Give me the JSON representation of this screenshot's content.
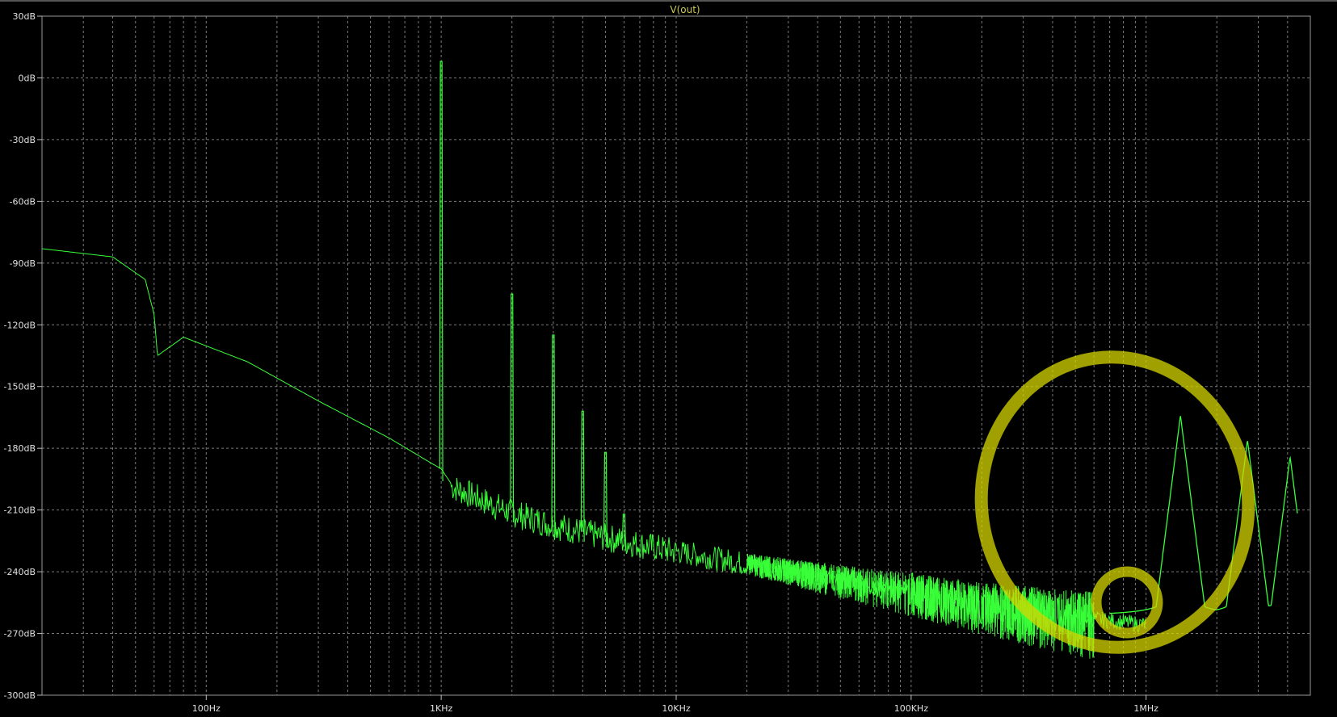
{
  "chart_data": {
    "type": "line",
    "title": "V(out)",
    "xlabel": "",
    "ylabel": "",
    "xscale": "log",
    "xlim": [
      20,
      5000000
    ],
    "ylim": [
      -300,
      30
    ],
    "grid": true,
    "colors": {
      "background": "#000000",
      "trace": "#39ff39",
      "grid": "#7a7a7a",
      "title": "#c8c850",
      "highlight": "#d6d600"
    },
    "y_ticks": [
      {
        "value": 30,
        "label": "30dB"
      },
      {
        "value": 0,
        "label": "0dB"
      },
      {
        "value": -30,
        "label": "-30dB"
      },
      {
        "value": -60,
        "label": "-60dB"
      },
      {
        "value": -90,
        "label": "-90dB"
      },
      {
        "value": -120,
        "label": "-120dB"
      },
      {
        "value": -150,
        "label": "-150dB"
      },
      {
        "value": -180,
        "label": "-180dB"
      },
      {
        "value": -210,
        "label": "-210dB"
      },
      {
        "value": -240,
        "label": "-240dB"
      },
      {
        "value": -270,
        "label": "-270dB"
      },
      {
        "value": -300,
        "label": "-300dB"
      }
    ],
    "x_ticks": [
      {
        "value": 100,
        "label": "100Hz"
      },
      {
        "value": 1000,
        "label": "1KHz"
      },
      {
        "value": 10000,
        "label": "10KHz"
      },
      {
        "value": 100000,
        "label": "100KHz"
      },
      {
        "value": 1000000,
        "label": "1MHz"
      }
    ],
    "series": [
      {
        "name": "V(out)",
        "noise_floor": {
          "x": [
            20,
            40,
            55,
            60,
            62,
            80,
            150,
            300,
            600,
            900,
            1000,
            1100,
            1500,
            2000,
            3000,
            5000,
            10000,
            20000,
            50000,
            100000,
            200000,
            400000,
            700000,
            1000000
          ],
          "y": [
            -83,
            -87,
            -98,
            -115,
            -135,
            -126,
            -138,
            -157,
            -175,
            -187,
            -190,
            -197,
            -204,
            -210,
            -216,
            -222,
            -229,
            -235,
            -243,
            -249,
            -255,
            -260,
            -263,
            -265
          ]
        },
        "harmonics": [
          {
            "x": 1000,
            "y": 8
          },
          {
            "x": 2000,
            "y": -105
          },
          {
            "x": 3000,
            "y": -125
          },
          {
            "x": 4000,
            "y": -162
          },
          {
            "x": 5000,
            "y": -182
          },
          {
            "x": 6000,
            "y": -212
          }
        ],
        "hf_peaks": {
          "x": [
            1000000,
            1200000,
            1300000,
            1380000,
            1450000,
            1700000,
            2000000,
            2300000,
            2600000,
            2700000,
            3000000,
            3500000,
            3900000,
            4100000,
            4300000
          ],
          "y": [
            -261,
            -258,
            -250,
            -236,
            -248,
            -260,
            -261,
            -255,
            -240,
            -176,
            -257,
            -268,
            -250,
            -184,
            -270
          ]
        },
        "hf_spike_x": [
          1400000,
          2700000,
          4100000
        ],
        "hf_spike_y": [
          -164,
          -176,
          -184
        ]
      }
    ]
  }
}
